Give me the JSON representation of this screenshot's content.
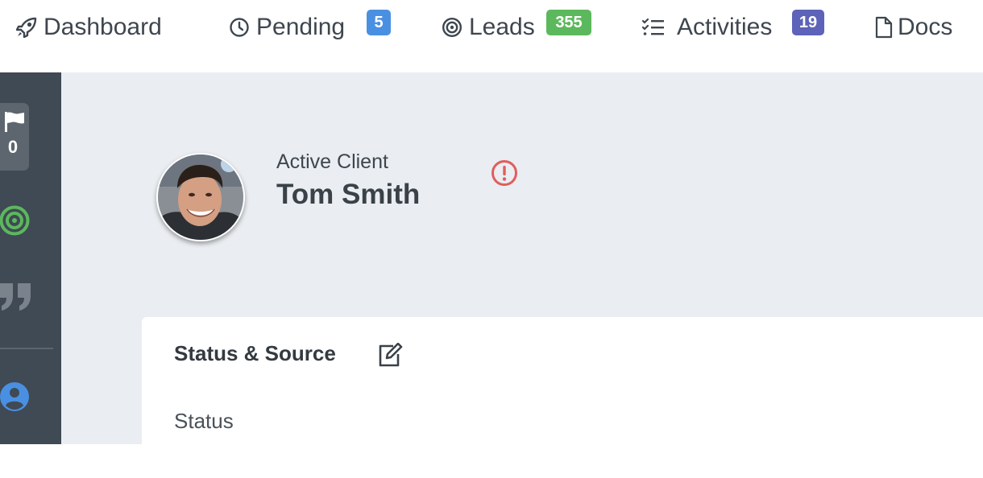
{
  "topnav": {
    "items": [
      {
        "label": "Dashboard",
        "icon": "rocket-icon"
      },
      {
        "label": "Pending",
        "icon": "clock-icon",
        "badge": "5",
        "badge_color": "#4a90e2"
      },
      {
        "label": "Leads",
        "icon": "target-icon",
        "badge": "355",
        "badge_color": "#5cb85c"
      },
      {
        "label": "Activities",
        "icon": "checklist-icon",
        "badge": "19",
        "badge_color": "#5c63b8"
      },
      {
        "label": "Docs",
        "icon": "document-icon"
      }
    ]
  },
  "sidebar": {
    "flag_count": "0",
    "icons": [
      "flag-icon",
      "target-icon",
      "quote-icon",
      "user-icon"
    ],
    "colors": {
      "target": "#5cb85c",
      "user": "#4a90e2",
      "background": "#3f4a55"
    }
  },
  "client": {
    "type": "Active Client",
    "name": "Tom Smith",
    "alert_color": "#e05d5d"
  },
  "card": {
    "title": "Status & Source",
    "status_label": "Status"
  }
}
